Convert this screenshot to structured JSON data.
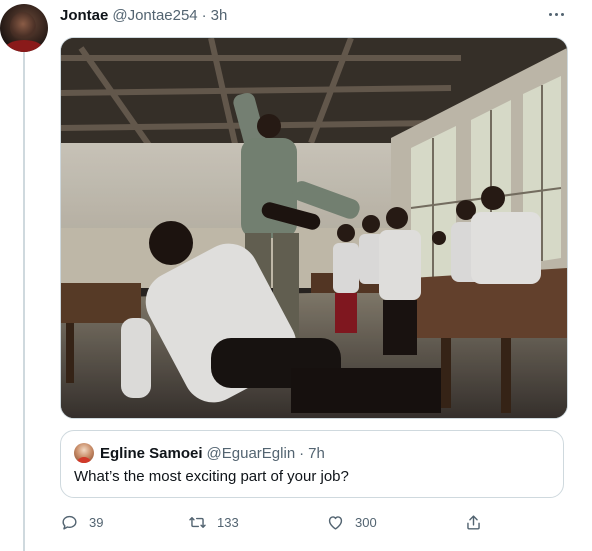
{
  "tweet": {
    "author_name": "Jontae",
    "author_handle": "@Jontae254",
    "separator": "·",
    "time": "3h",
    "avatar_icon": "user-avatar",
    "more_icon": "more-horizontal-icon"
  },
  "quoted_tweet": {
    "author_name": "Egline Samoei",
    "author_handle": "@EguarEglin",
    "separator": "·",
    "time": "7h",
    "text": "What’s the most exciting part of your job?"
  },
  "actions": {
    "replies": "39",
    "retweets": "133",
    "likes": "300"
  },
  "colors": {
    "text_primary": "#0f1419",
    "text_secondary": "#536471",
    "border": "#cfd9de",
    "background": "#ffffff"
  }
}
